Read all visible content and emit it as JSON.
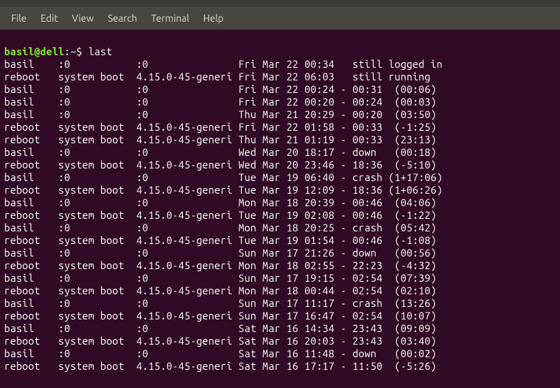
{
  "menubar": {
    "file": "File",
    "edit": "Edit",
    "view": "View",
    "search": "Search",
    "terminal": "Terminal",
    "help": "Help"
  },
  "prompt": {
    "user_host": "basil@dell",
    "colon": ":",
    "path": "~",
    "symbol": "$ "
  },
  "command": "last",
  "rows": [
    "basil    :0           :0               Fri Mar 22 00:34   still logged in",
    "reboot   system boot  4.15.0-45-generi Fri Mar 22 06:03   still running",
    "basil    :0           :0               Fri Mar 22 00:24 - 00:31  (00:06)",
    "basil    :0           :0               Fri Mar 22 00:20 - 00:24  (00:03)",
    "basil    :0           :0               Thu Mar 21 20:29 - 00:20  (03:50)",
    "reboot   system boot  4.15.0-45-generi Fri Mar 22 01:58 - 00:33  (-1:25)",
    "reboot   system boot  4.15.0-45-generi Thu Mar 21 01:19 - 00:33  (23:13)",
    "basil    :0           :0               Wed Mar 20 18:17 - down   (00:18)",
    "reboot   system boot  4.15.0-45-generi Wed Mar 20 23:46 - 18:36  (-5:10)",
    "basil    :0           :0               Tue Mar 19 06:40 - crash (1+17:06)",
    "reboot   system boot  4.15.0-45-generi Tue Mar 19 12:09 - 18:36 (1+06:26)",
    "basil    :0           :0               Mon Mar 18 20:39 - 00:46  (04:06)",
    "reboot   system boot  4.15.0-45-generi Tue Mar 19 02:08 - 00:46  (-1:22)",
    "basil    :0           :0               Mon Mar 18 20:25 - crash  (05:42)",
    "reboot   system boot  4.15.0-45-generi Tue Mar 19 01:54 - 00:46  (-1:08)",
    "basil    :0           :0               Sun Mar 17 21:26 - down   (00:56)",
    "reboot   system boot  4.15.0-45-generi Mon Mar 18 02:55 - 22:23  (-4:32)",
    "basil    :0           :0               Sun Mar 17 19:15 - 02:54  (07:39)",
    "reboot   system boot  4.15.0-45-generi Mon Mar 18 00:44 - 02:54  (02:10)",
    "basil    :0           :0               Sun Mar 17 11:17 - crash  (13:26)",
    "reboot   system boot  4.15.0-45-generi Sun Mar 17 16:47 - 02:54  (10:07)",
    "basil    :0           :0               Sat Mar 16 14:34 - 23:43  (09:09)",
    "reboot   system boot  4.15.0-45-generi Sat Mar 16 20:03 - 23:43  (03:40)",
    "basil    :0           :0               Sat Mar 16 11:48 - down   (00:02)",
    "reboot   system boot  4.15.0-45-generi Sat Mar 16 17:17 - 11:50  (-5:26)"
  ]
}
